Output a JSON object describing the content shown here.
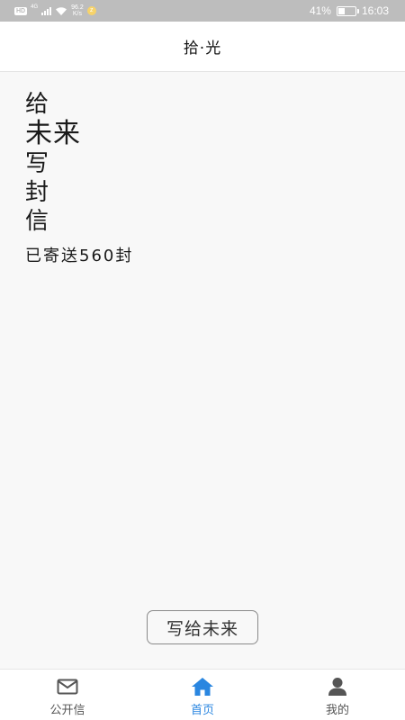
{
  "status_bar": {
    "hd": "HD",
    "network": "4G",
    "speed_value": "96.2",
    "speed_unit": "K/s",
    "notification_glyph": "z",
    "battery_text": "41%",
    "battery_level": 0.41,
    "time": "16:03"
  },
  "header": {
    "title": "拾·光"
  },
  "hero": {
    "lines": [
      "给",
      "未来",
      "写",
      "封",
      "信"
    ],
    "sent_count": "已寄送560封"
  },
  "actions": {
    "write_label": "写给未来"
  },
  "bottom_nav": {
    "items": [
      {
        "label": "公开信",
        "icon": "mail-icon"
      },
      {
        "label": "首页",
        "icon": "home-icon"
      },
      {
        "label": "我的",
        "icon": "user-icon"
      }
    ]
  },
  "colors": {
    "accent": "#2a86e0",
    "icon_gray": "#555555",
    "status_bar": "#bdbdbd"
  }
}
